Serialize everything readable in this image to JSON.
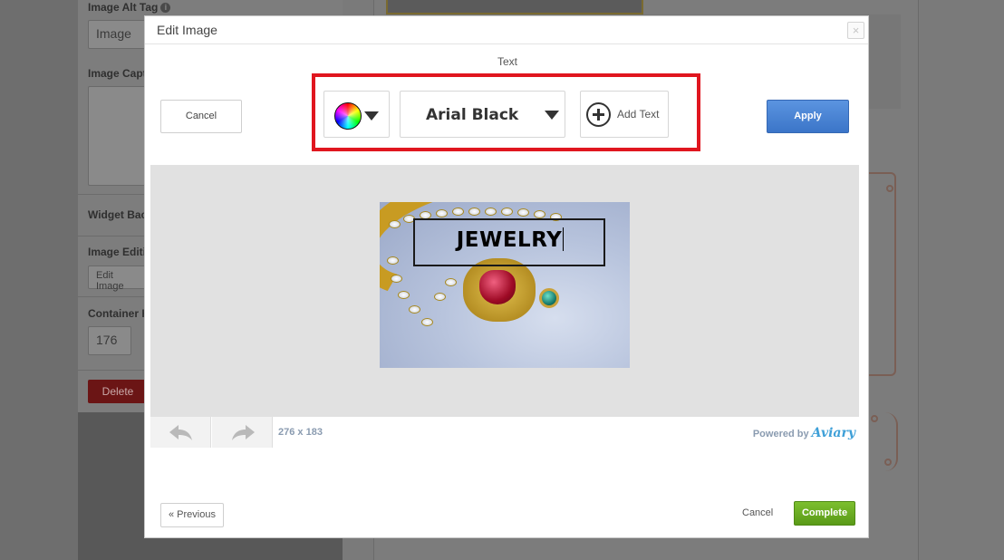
{
  "background": {
    "image_alt_tag_label": "Image Alt Tag",
    "image_alt_value": "Image",
    "image_caption_label": "Image Capt",
    "widget_bg_label": "Widget Bac",
    "image_editing_label": "Image Editi",
    "edit_image_button": "Edit Image",
    "container_label": "Container H",
    "container_value": "176",
    "delete_button": "Delete"
  },
  "modal": {
    "title": "Edit Image",
    "close_glyph": "×",
    "tool_label": "Text",
    "cancel_top": "Cancel",
    "apply": "Apply",
    "font_name": "Arial Black",
    "add_text": "Add Text",
    "canvas_text": "JEWELRY",
    "image_dims": "276 x 183",
    "powered_by": "Powered by",
    "powered_brand": "Aviary",
    "previous": "« Previous",
    "cancel_bottom": "Cancel",
    "complete": "Complete"
  },
  "colors": {
    "highlight": "#e0161f",
    "apply": "#3b75c8",
    "complete": "#5a9a18",
    "delete": "#6b1515"
  },
  "icons": [
    "info-icon",
    "close-icon",
    "color-wheel-icon",
    "chevron-down-icon",
    "plus-circle-icon",
    "undo-icon",
    "redo-icon"
  ]
}
